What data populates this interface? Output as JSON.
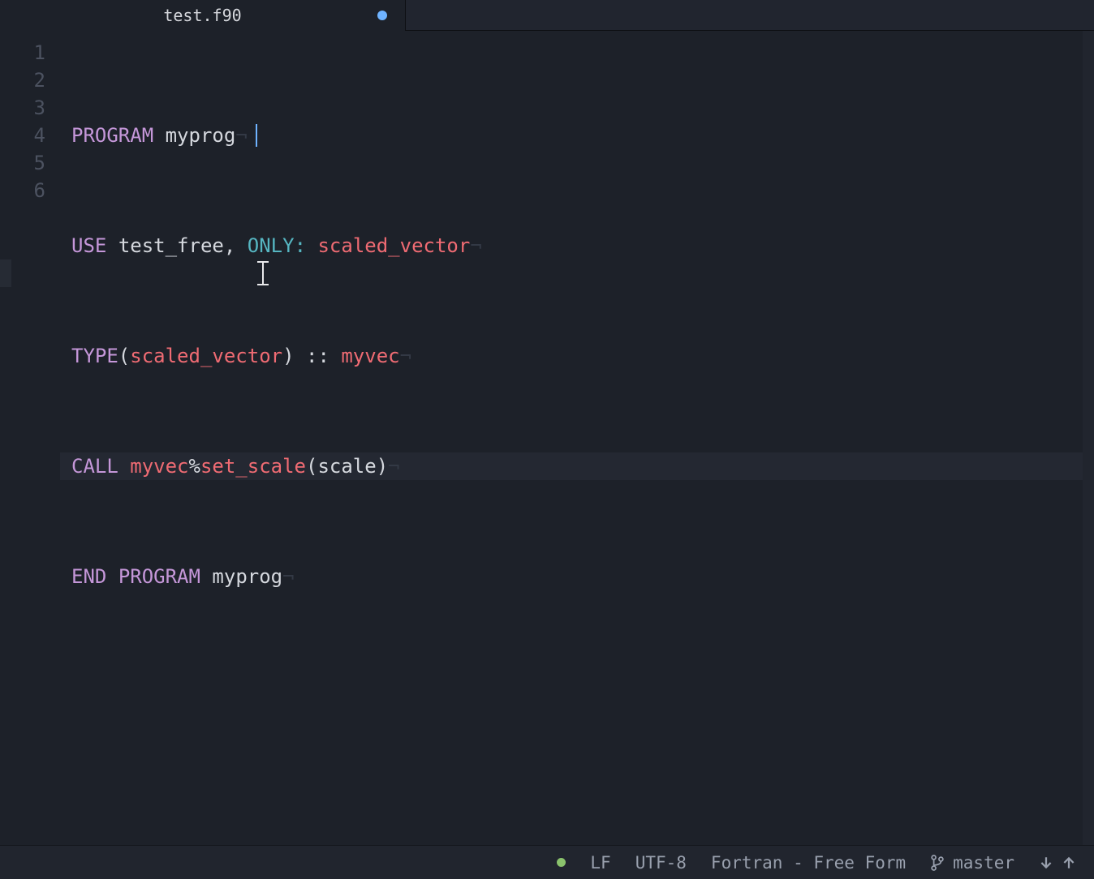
{
  "tab": {
    "title": "test.f90",
    "dirty": true
  },
  "gutter": [
    "1",
    "2",
    "3",
    "4",
    "5",
    "6"
  ],
  "code": {
    "l1": {
      "kw": "PROGRAM",
      "name": "myprog"
    },
    "l2": {
      "kw": "USE",
      "mod": "test_free",
      "comma": ",",
      "only": "ONLY",
      "colon": ":",
      "imp": "scaled_vector"
    },
    "l3": {
      "kw": "TYPE",
      "lpar": "(",
      "t": "scaled_vector",
      "rpar": ")",
      "dcolon": " :: ",
      "var": "myvec"
    },
    "l4": {
      "kw": "CALL",
      "obj": "myvec",
      "pct": "%",
      "m1": "s",
      "m2": "et_scale",
      "lpar": "(",
      "arg": "scale",
      "rpar": ")"
    },
    "l5": {
      "kw1": "END",
      "kw2": "PROGRAM",
      "name": "myprog"
    },
    "nl": "¬"
  },
  "status": {
    "eol": "LF",
    "encoding": "UTF-8",
    "grammar": "Fortran - Free Form",
    "branch": "master"
  }
}
